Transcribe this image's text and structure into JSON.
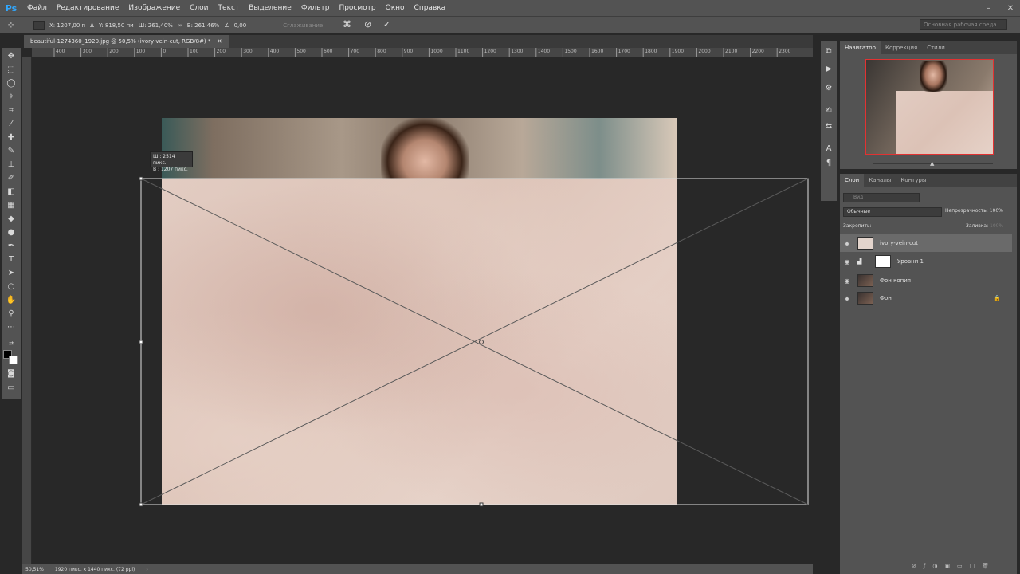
{
  "app": {
    "logo": "Ps"
  },
  "menu": [
    "Файл",
    "Редактирование",
    "Изображение",
    "Слои",
    "Текст",
    "Выделение",
    "Фильтр",
    "Просмотр",
    "Окно",
    "Справка"
  ],
  "options": {
    "x": "X: 1207,00 п",
    "y": "Y: 818,50 пи",
    "w": "Ш: 261,40%",
    "h": "В: 261,46%",
    "angle": "0,00",
    "interp": "Сглаживание",
    "workspace": "Основная рабочая среда"
  },
  "document": {
    "tab_title": "beautiful-1274360_1920.jpg @ 50,5% (ivory-vein-cut, RGB/8#) *",
    "tooltip_w": "Ш : 2514 пикс.",
    "tooltip_h": "В : 1207 пикс."
  },
  "ruler": [
    "400",
    "300",
    "200",
    "100",
    "0",
    "100",
    "200",
    "300",
    "400",
    "500",
    "600",
    "700",
    "800",
    "900",
    "1000",
    "1100",
    "1200",
    "1300",
    "1400",
    "1500",
    "1600",
    "1700",
    "1800",
    "1900",
    "2000",
    "2100",
    "2200",
    "2300"
  ],
  "status": {
    "zoom": "50,51%",
    "doc_info": "1920 пикс. x 1440 пикс. (72 ppi)"
  },
  "nav_tabs": [
    "Навигатор",
    "Коррекция",
    "Стили"
  ],
  "layers_tabs": [
    "Слои",
    "Каналы",
    "Контуры"
  ],
  "layers_panel": {
    "search": "Вид",
    "blend": "Обычные",
    "opacity_label": "Непрозрачность:",
    "opacity": "100%",
    "lock_label": "Закрепить:",
    "fill_label": "Заливка:",
    "fill": "100%"
  },
  "layers": [
    {
      "name": "ivory-vein-cut",
      "selected": true
    },
    {
      "name": "Уровни 1",
      "selected": false
    },
    {
      "name": "Фон копия",
      "selected": false
    },
    {
      "name": "Фон",
      "selected": false
    }
  ]
}
